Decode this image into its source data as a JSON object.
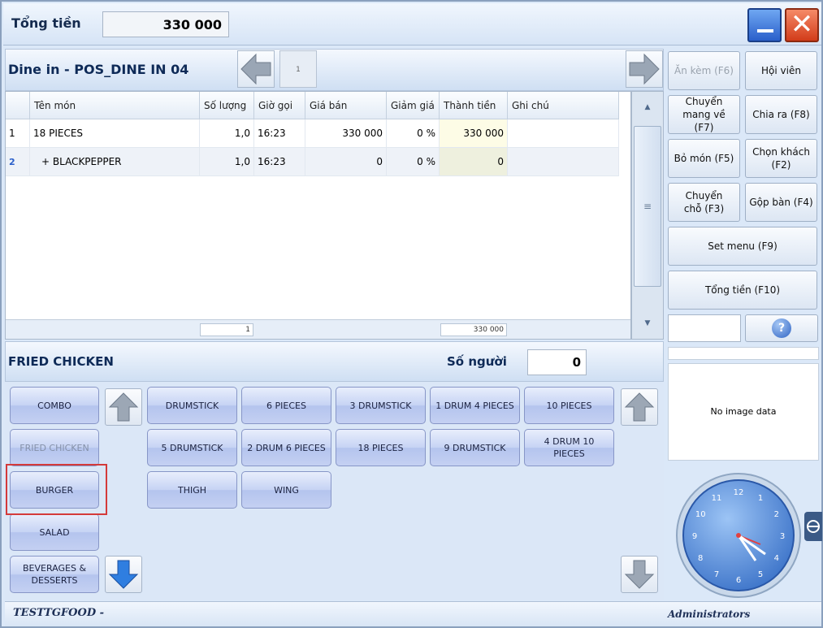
{
  "header": {
    "total_label": "Tổng tiền",
    "total_value": "330 000"
  },
  "order": {
    "title": "Dine in - POS_DINE IN 04",
    "page": "1",
    "columns": [
      "",
      "Tên món",
      "Số lượng",
      "Giờ gọi",
      "Giá bán",
      "Giảm giá",
      "Thành tiền",
      "Ghi chú"
    ],
    "rows": [
      {
        "no": "1",
        "name": "18 PIECES",
        "qty": "1,0",
        "time": "16:23",
        "price": "330 000",
        "discount": "0 %",
        "amount": "330 000",
        "note": ""
      },
      {
        "no": "2",
        "name": "+ BLACKPEPPER",
        "qty": "1,0",
        "time": "16:23",
        "price": "0",
        "discount": "0 %",
        "amount": "0",
        "note": ""
      }
    ],
    "footer_qty": "1",
    "footer_amount": "330 000"
  },
  "side": {
    "buttons": {
      "an_kem": "Ăn kèm (F6)",
      "hoi_vien": "Hội viên",
      "chuyen_mang": "Chuyển mang về (F7)",
      "chia_ra": "Chia ra (F8)",
      "bo_mon": "Bỏ món (F5)",
      "chon_khach": "Chọn khách (F2)",
      "chuyen_cho": "Chuyển chỗ (F3)",
      "gop_ban": "Gộp bàn (F4)",
      "set_menu": "Set menu (F9)",
      "tong_tien": "Tổng tiền (F10)"
    },
    "help": "?",
    "image_text": "No image data"
  },
  "category": {
    "title": "FRIED CHICKEN",
    "people_label": "Số người",
    "people_value": "0",
    "groups": [
      "COMBO",
      "FRIED CHICKEN",
      "BURGER",
      "SALAD",
      "BEVERAGES & DESSERTS"
    ],
    "items": [
      "DRUMSTICK",
      "6 PIECES",
      "3 DRUMSTICK",
      "1 DRUM 4 PIECES",
      "10 PIECES",
      "5 DRUMSTICK",
      "2 DRUM 6 PIECES",
      "18 PIECES",
      "9 DRUMSTICK",
      "4 DRUM 10 PIECES",
      "THIGH",
      "WING"
    ]
  },
  "clock": {
    "numbers": [
      "12",
      "1",
      "2",
      "3",
      "4",
      "5",
      "6",
      "7",
      "8",
      "9",
      "10",
      "11"
    ]
  },
  "status": {
    "company": "TESTTGFOOD -",
    "user": "Administrators"
  },
  "colors": {
    "accent": "#2a5fca",
    "close": "#d23c1a",
    "highlight": "#d43a3a"
  }
}
